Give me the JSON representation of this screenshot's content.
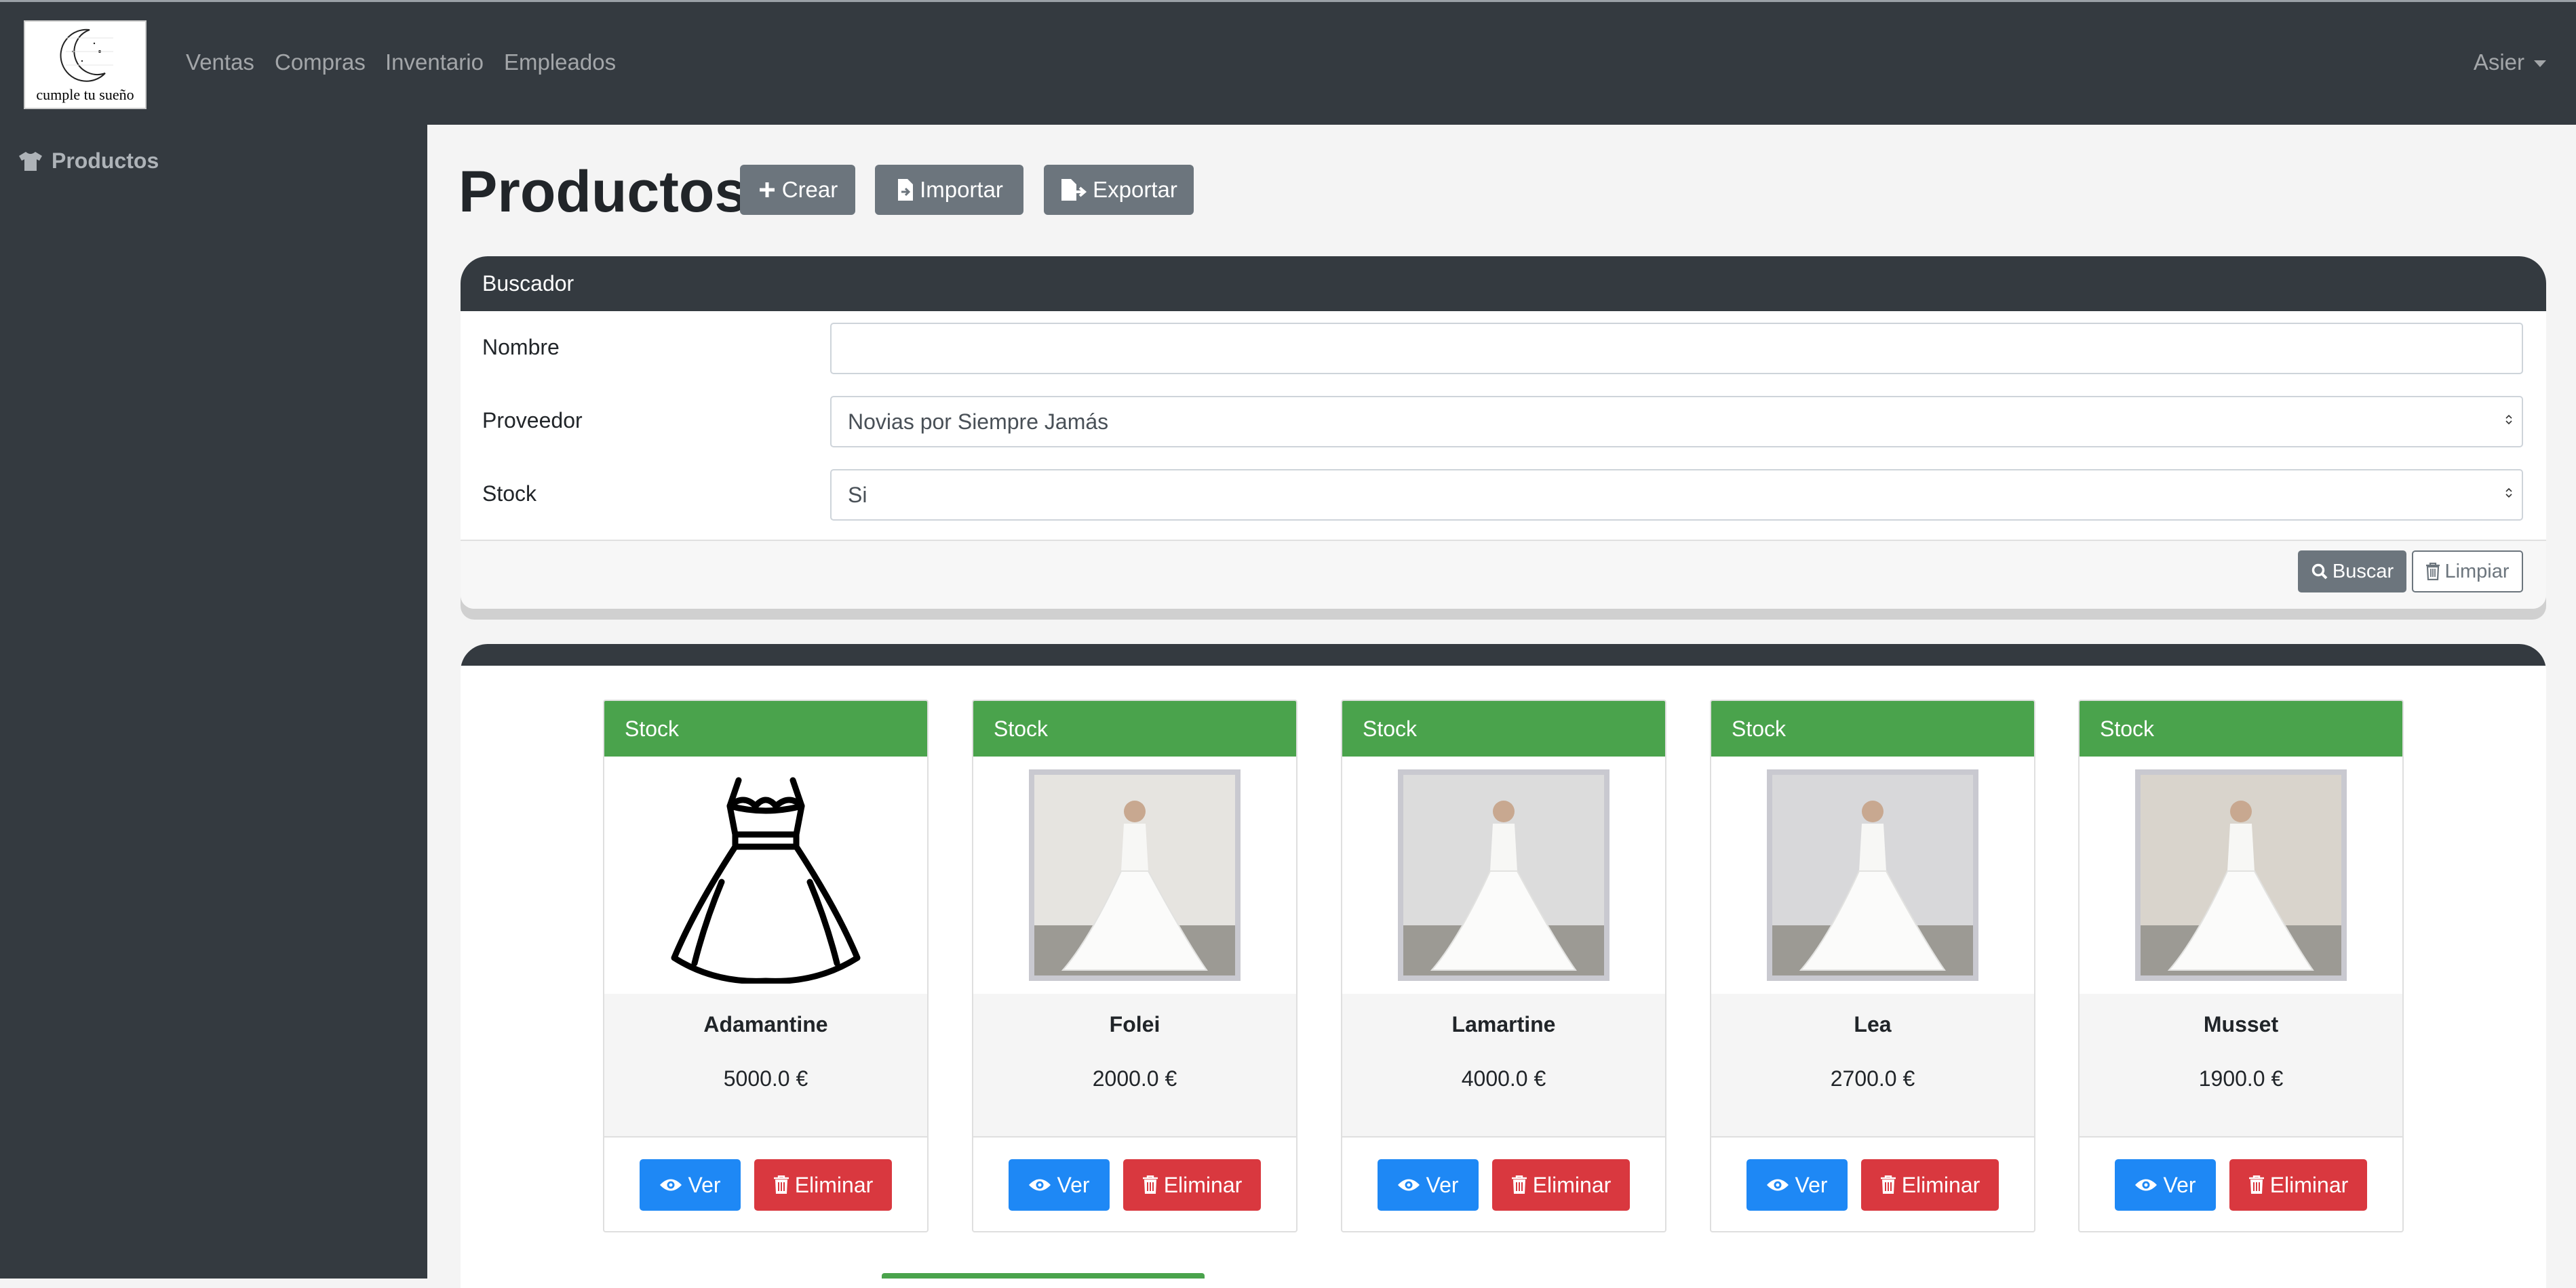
{
  "navbar": {
    "logo_text": "cumple tu sueño",
    "links": [
      "Ventas",
      "Compras",
      "Inventario",
      "Empleados"
    ],
    "user": "Asier"
  },
  "sidebar": {
    "items": [
      {
        "label": "Productos",
        "icon": "tshirt-icon"
      }
    ]
  },
  "page": {
    "title": "Productos",
    "actions": {
      "create": "Crear",
      "import": "Importar",
      "export": "Exportar"
    }
  },
  "search": {
    "header": "Buscador",
    "fields": {
      "name": {
        "label": "Nombre",
        "value": ""
      },
      "provider": {
        "label": "Proveedor",
        "value": "Novias por Siempre Jamás"
      },
      "stock": {
        "label": "Stock",
        "value": "Si"
      }
    },
    "buttons": {
      "search": "Buscar",
      "clear": "Limpiar"
    }
  },
  "products": [
    {
      "badge": "Stock",
      "name": "Adamantine",
      "price": "5000.0 €",
      "image": "dress-outline-icon"
    },
    {
      "badge": "Stock",
      "name": "Folei",
      "price": "2000.0 €",
      "image": "wedding-dress-photo"
    },
    {
      "badge": "Stock",
      "name": "Lamartine",
      "price": "4000.0 €",
      "image": "wedding-dress-photo"
    },
    {
      "badge": "Stock",
      "name": "Lea",
      "price": "2700.0 €",
      "image": "wedding-dress-photo"
    },
    {
      "badge": "Stock",
      "name": "Musset",
      "price": "1900.0 €",
      "image": "wedding-dress-photo"
    }
  ],
  "product_actions": {
    "view": "Ver",
    "delete": "Eliminar"
  },
  "colors": {
    "navbar": "#343a40",
    "stock_badge": "#4aa34c",
    "view_button": "#1e88f5",
    "delete_button": "#d9383f",
    "secondary_button": "#6c757d"
  }
}
